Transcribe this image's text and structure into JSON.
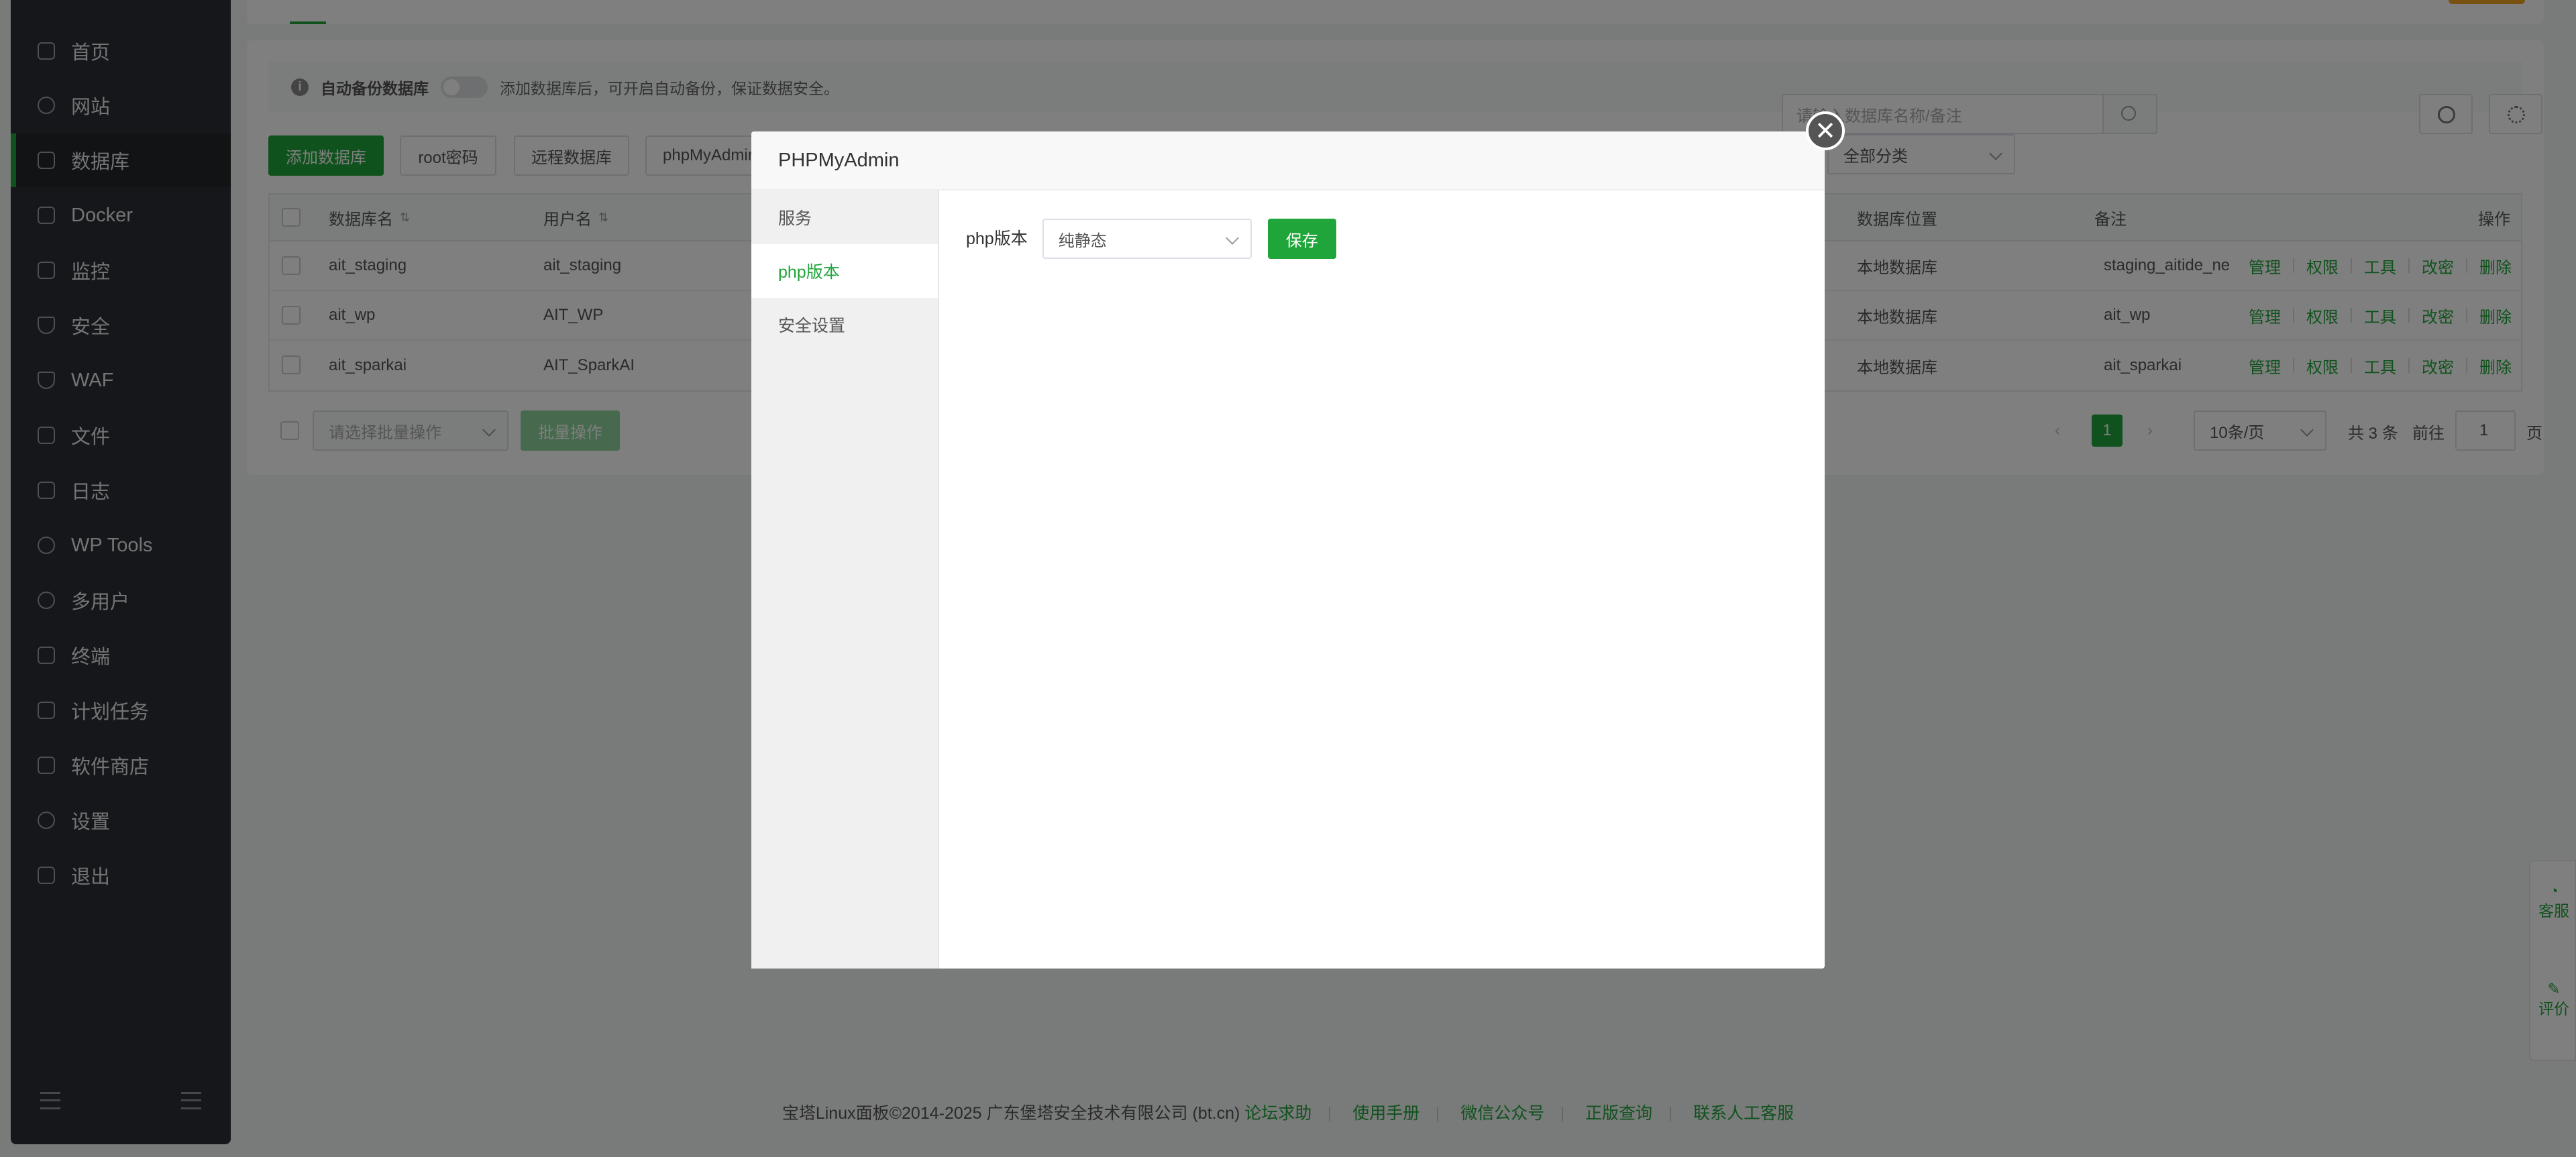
{
  "sidebar": {
    "items": [
      {
        "label": "首页",
        "icon": "home-icon"
      },
      {
        "label": "网站",
        "icon": "globe-icon"
      },
      {
        "label": "数据库",
        "icon": "database-icon",
        "active": true
      },
      {
        "label": "Docker",
        "icon": "docker-icon"
      },
      {
        "label": "监控",
        "icon": "monitor-icon"
      },
      {
        "label": "安全",
        "icon": "shield-icon"
      },
      {
        "label": "WAF",
        "icon": "waf-shield-icon"
      },
      {
        "label": "文件",
        "icon": "folder-icon"
      },
      {
        "label": "日志",
        "icon": "log-icon"
      },
      {
        "label": "WP Tools",
        "icon": "wordpress-icon"
      },
      {
        "label": "多用户",
        "icon": "users-icon"
      },
      {
        "label": "终端",
        "icon": "terminal-icon"
      },
      {
        "label": "计划任务",
        "icon": "calendar-icon"
      },
      {
        "label": "软件商店",
        "icon": "grid-icon"
      },
      {
        "label": "设置",
        "icon": "gear-icon"
      },
      {
        "label": "退出",
        "icon": "logout-icon"
      }
    ]
  },
  "notice": {
    "label": "自动备份数据库",
    "text": "添加数据库后，可开启自动备份，保证数据安全。"
  },
  "toolbar": {
    "add_db": "添加数据库",
    "root_pw": "root密码",
    "remote_db": "远程数据库",
    "phpmyadmin": "phpMyAdmin",
    "category": "全部分类",
    "search_placeholder": "请输入数据库名称/备注"
  },
  "table": {
    "headers": {
      "name": "数据库名",
      "user": "用户名",
      "location": "数据库位置",
      "remark": "备注",
      "ops": "操作"
    },
    "rows": [
      {
        "name": "ait_staging",
        "user": "ait_staging",
        "location": "本地数据库",
        "remark": "staging_aitide_ne"
      },
      {
        "name": "ait_wp",
        "user": "AIT_WP",
        "location": "本地数据库",
        "remark": "ait_wp"
      },
      {
        "name": "ait_sparkai",
        "user": "AIT_SparkAI",
        "location": "本地数据库",
        "remark": "ait_sparkai"
      }
    ],
    "ops": [
      "管理",
      "权限",
      "工具",
      "改密",
      "删除"
    ]
  },
  "batch": {
    "placeholder": "请选择批量操作",
    "button": "批量操作"
  },
  "pagination": {
    "current_page": "1",
    "page_size": "10条/页",
    "total_prefix": "共",
    "total_count": "3",
    "total_suffix": "条",
    "goto_label": "前往",
    "goto_value": "1",
    "goto_suffix": "页"
  },
  "footer": {
    "copyright": "宝塔Linux面板©2014-2025 广东堡塔安全技术有限公司 (bt.cn)",
    "links": [
      "论坛求助",
      "使用手册",
      "微信公众号",
      "正版查询",
      "联系人工客服"
    ]
  },
  "float_panel": {
    "service": "客服",
    "rate": "评价"
  },
  "modal": {
    "title": "PHPMyAdmin",
    "tabs": [
      "服务",
      "php版本",
      "安全设置"
    ],
    "active_tab": 1,
    "php_label": "php版本",
    "php_value": "纯静态",
    "save": "保存"
  },
  "colors": {
    "accent": "#20a53a",
    "sidebar_bg": "#2b2f34"
  }
}
